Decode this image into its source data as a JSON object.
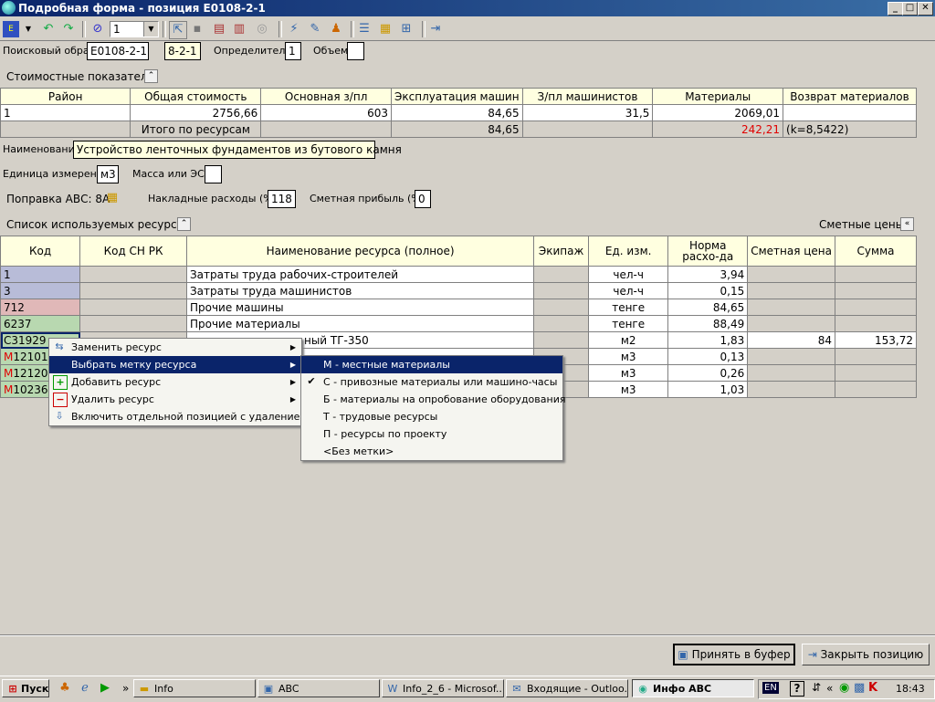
{
  "window": {
    "title": "Подробная форма - позиция Е0108-2-1",
    "min": "_",
    "max": "□",
    "close": "✕"
  },
  "toolbar": {
    "combo_value": "1"
  },
  "search": {
    "label": "Поисковый образ",
    "value": "Е0108-2-1",
    "code": "8-2-1",
    "determinant_label": "Определитель",
    "determinant": "1",
    "volume_label": "Объем",
    "volume": ""
  },
  "cost": {
    "section_label": "Стоимостные показатели",
    "headers": [
      "Район",
      "Общая стоимость",
      "Основная з/пл",
      "Эксплуатация машин",
      "З/пл машинистов",
      "Материалы",
      "Возврат материалов"
    ],
    "row": [
      "1",
      "2756,66",
      "603",
      "84,65",
      "31,5",
      "2069,01",
      ""
    ],
    "total_label": "Итого по ресурсам",
    "total_machines": "84,65",
    "total_materials": "242,21",
    "total_k": "(k=8,5422)"
  },
  "info": {
    "name_label": "Наименование",
    "name": "Устройство ленточных фундаментов из бутового камня",
    "unit_label": "Единица измерения",
    "unit": "м3",
    "mass_label": "Масса или ЭСН",
    "mass": "",
    "abc_label": "Поправка АВС: 8А",
    "overhead_label": "Накладные расходы (%)",
    "overhead": "118",
    "profit_label": "Сметная прибыль (%)",
    "profit": "0"
  },
  "resources": {
    "section_label": "Список используемых ресурсов",
    "prices_label": "Сметные цены",
    "headers": [
      "Код",
      "Код СН РК",
      "Наименование ресурса (полное)",
      "Экипаж",
      "Ед. изм.",
      "Норма расхо-да",
      "Сметная цена",
      "Сумма"
    ],
    "rows": [
      {
        "code": "1",
        "sn": "",
        "name": "Затраты труда рабочих-строителей",
        "crew": "",
        "unit": "чел-ч",
        "norm": "3,94",
        "price": "",
        "sum": ""
      },
      {
        "code": "3",
        "sn": "",
        "name": "Затраты труда машинистов",
        "crew": "",
        "unit": "чел-ч",
        "norm": "0,15",
        "price": "",
        "sum": ""
      },
      {
        "code": "712",
        "sn": "",
        "name": "Прочие машины",
        "crew": "",
        "unit": "тенге",
        "norm": "84,65",
        "price": "",
        "sum": ""
      },
      {
        "code": "6237",
        "sn": "",
        "name": "Прочие материалы",
        "crew": "",
        "unit": "тенге",
        "norm": "88,49",
        "price": "",
        "sum": ""
      },
      {
        "code_prefix": "С",
        "code": "31929",
        "sn": "",
        "name": "ный ТГ-350",
        "crew": "",
        "unit": "м2",
        "norm": "1,83",
        "price": "84",
        "sum": "153,72"
      },
      {
        "code_prefix": "М",
        "code": "12101",
        "sn": "",
        "name": "",
        "crew": "",
        "unit": "м3",
        "norm": "0,13",
        "price": "",
        "sum": ""
      },
      {
        "code_prefix": "М",
        "code": "12120",
        "sn": "",
        "name": "",
        "crew": "",
        "unit": "м3",
        "norm": "0,26",
        "price": "",
        "sum": ""
      },
      {
        "code_prefix": "М",
        "code": "10236",
        "sn": "",
        "name": "",
        "crew": "",
        "unit": "м3",
        "norm": "1,03",
        "price": "",
        "sum": ""
      }
    ]
  },
  "context_menu": {
    "items": [
      "Заменить ресурс",
      "Выбрать метку ресурса",
      "Добавить ресурс",
      "Удалить ресурс",
      "Включить отдельной позицией с удалением"
    ]
  },
  "submenu": {
    "items": [
      "М - местные материалы",
      "С - привозные материалы или машино-часы",
      "Б - материалы на опробование оборудования",
      "Т - трудовые ресурсы",
      "П - ресурсы по проекту",
      "<Без метки>"
    ]
  },
  "buttons": {
    "accept": "Принять в буфер",
    "close": "Закрыть позицию"
  },
  "taskbar": {
    "start": "Пуск",
    "quick_arrow": "»",
    "tasks": [
      "Info",
      "ABC",
      "Info_2_6 - Microsof...",
      "Входящие - Outloo...",
      "Инфо АВС"
    ],
    "lang": "EN",
    "help": "?",
    "tray_arrow": "«",
    "clock": "18:43"
  },
  "colors": {
    "code_labor": "#b8bcd8",
    "code_machine": "#e0b8b8",
    "code_material": "#b8d8b0",
    "selection": "#0a246a"
  }
}
